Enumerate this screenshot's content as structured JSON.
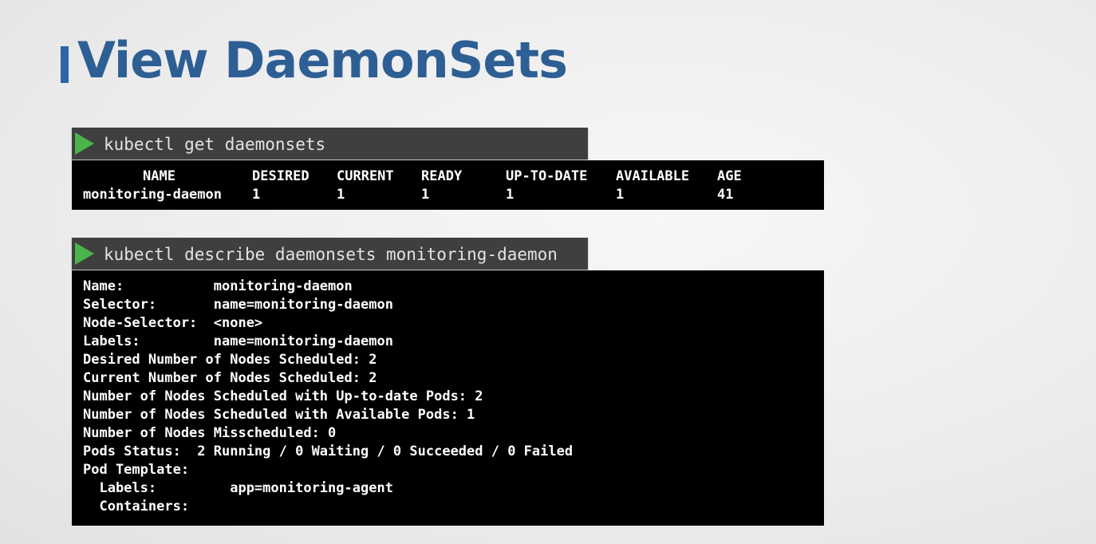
{
  "slide": {
    "title": "View DaemonSets"
  },
  "commands": {
    "get": "kubectl get daemonsets",
    "describe": "kubectl describe daemonsets monitoring-daemon"
  },
  "get_table": {
    "headers": [
      "NAME",
      "DESIRED",
      "CURRENT",
      "READY",
      "UP-TO-DATE",
      "AVAILABLE",
      "AGE"
    ],
    "rows": [
      [
        "monitoring-daemon",
        "1",
        "1",
        "1",
        "1",
        "1",
        "41"
      ]
    ]
  },
  "describe_output": {
    "lines": [
      "Name:           monitoring-daemon",
      "Selector:       name=monitoring-daemon",
      "Node-Selector:  <none>",
      "Labels:         name=monitoring-daemon",
      "Desired Number of Nodes Scheduled: 2",
      "Current Number of Nodes Scheduled: 2",
      "Number of Nodes Scheduled with Up-to-date Pods: 2",
      "Number of Nodes Scheduled with Available Pods: 1",
      "Number of Nodes Misscheduled: 0",
      "Pods Status:  2 Running / 0 Waiting / 0 Succeeded / 0 Failed",
      "Pod Template:",
      "  Labels:         app=monitoring-agent",
      "  Containers:"
    ]
  },
  "colors": {
    "title": "#2d5f94",
    "title_accent": "#2c64a8",
    "command_bar": "#3f3f3f",
    "play_icon": "#4ab44a",
    "terminal_bg": "#000000",
    "terminal_text": "#ffffff"
  },
  "icons": {
    "command_prompt": "play-icon"
  }
}
